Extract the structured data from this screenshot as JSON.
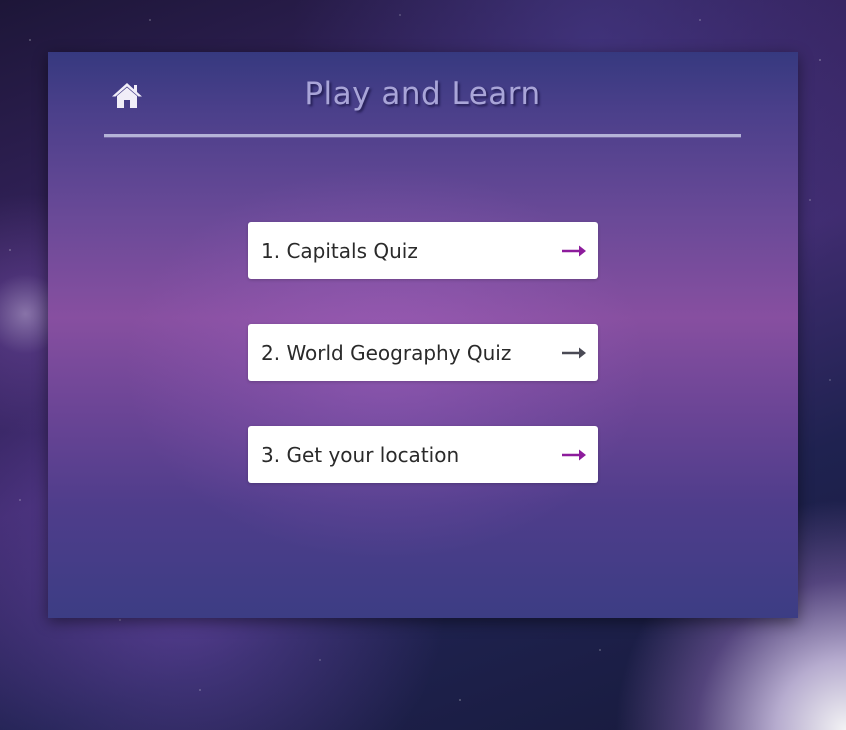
{
  "header": {
    "title": "Play and Learn",
    "home_icon": "home-icon"
  },
  "menu": {
    "items": [
      {
        "label": "1. Capitals Quiz",
        "icon": "arrow-right-icon",
        "arrow_color": "#8d1c9c"
      },
      {
        "label": "2. World Geography Quiz",
        "icon": "arrow-right-icon",
        "arrow_color": "#4a4a55"
      },
      {
        "label": "3. Get your location",
        "icon": "arrow-right-icon",
        "arrow_color": "#8d1c9c"
      }
    ]
  },
  "colors": {
    "title": "#a9a5d8",
    "header_rule": "#b4b3d8",
    "card_background": "#ffffff",
    "accent": "#8d1c9c"
  }
}
